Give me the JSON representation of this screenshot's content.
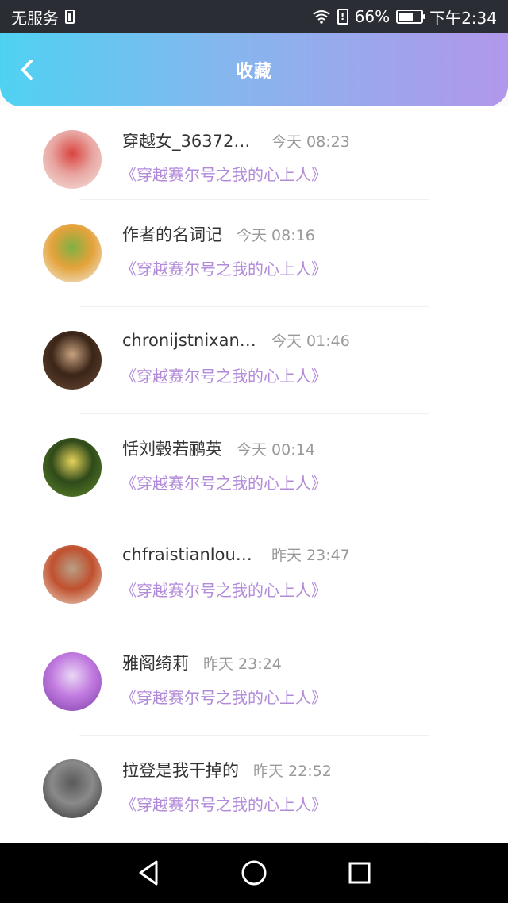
{
  "status_bar": {
    "carrier": "无服务",
    "battery_percent": "66%",
    "battery_level": 0.66,
    "time": "下午2:34"
  },
  "header": {
    "title": "收藏",
    "back_icon": "chevron-left-icon"
  },
  "items": [
    {
      "name": "穿越女_363721...",
      "time": "今天 08:23",
      "book": "《穿越赛尔号之我的心上人》",
      "avatar_colors": [
        "#f5e6e0",
        "#d9443f",
        "#e8a4a0"
      ]
    },
    {
      "name": "作者的名词记",
      "time": "今天 08:16",
      "book": "《穿越赛尔号之我的心上人》",
      "avatar_colors": [
        "#f3efe6",
        "#7fb044",
        "#e4a23a"
      ]
    },
    {
      "name": "chronijstnixand...",
      "time": "今天 01:46",
      "book": "《穿越赛尔号之我的心上人》",
      "avatar_colors": [
        "#6b4a35",
        "#c9a27f",
        "#3a2518"
      ]
    },
    {
      "name": "恬刘毂若鹂英",
      "time": "今天 00:14",
      "book": "《穿越赛尔号之我的心上人》",
      "avatar_colors": [
        "#5f8a2b",
        "#e7d35b",
        "#2f4a1a"
      ]
    },
    {
      "name": "chfraistianloub...",
      "time": "昨天 23:47",
      "book": "《穿越赛尔号之我的心上人》",
      "avatar_colors": [
        "#e9dccb",
        "#b8a087",
        "#c0502e"
      ]
    },
    {
      "name": "雅阁绮莉",
      "time": "昨天 23:24",
      "book": "《穿越赛尔号之我的心上人》",
      "avatar_colors": [
        "#7b3fa6",
        "#e9d7f4",
        "#c27be0"
      ]
    },
    {
      "name": "拉登是我干掉的",
      "time": "昨天 22:52",
      "book": "《穿越赛尔号之我的心上人》",
      "avatar_colors": [
        "#2d2d2d",
        "#5a5a5a",
        "#8a8a8a"
      ]
    }
  ],
  "nav_bar": {
    "back_icon": "triangle-back-icon",
    "home_icon": "circle-home-icon",
    "recents_icon": "square-recents-icon"
  }
}
